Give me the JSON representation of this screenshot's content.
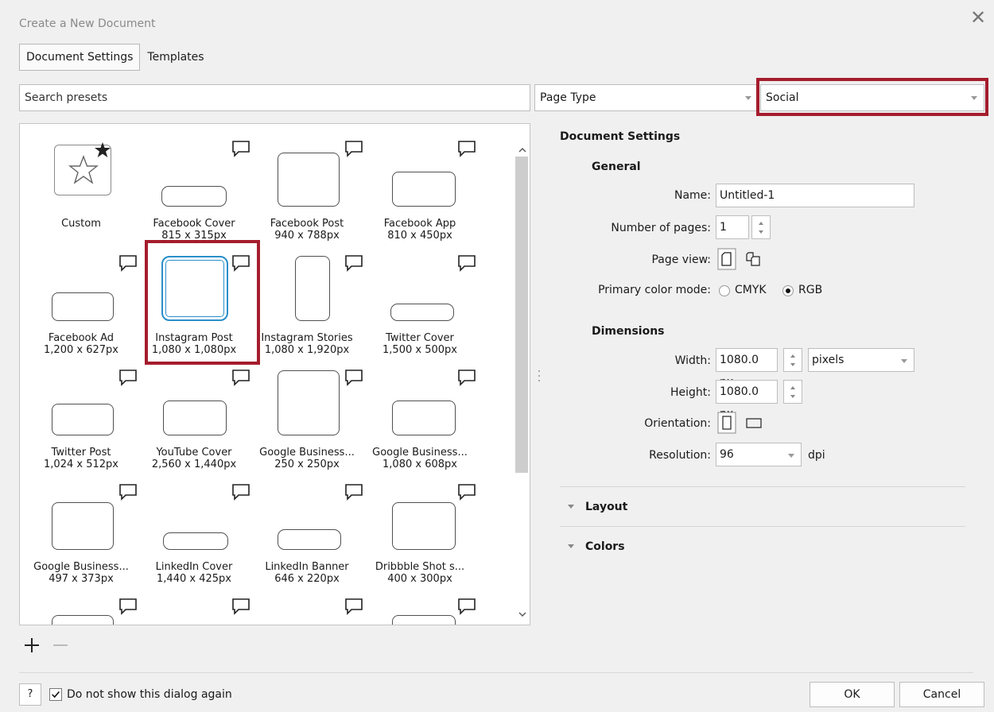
{
  "window": {
    "title": "Create a New Document"
  },
  "tabs": [
    {
      "label": "Document Settings",
      "active": true
    },
    {
      "label": "Templates",
      "active": false
    }
  ],
  "search": {
    "placeholder": "Search presets"
  },
  "filters": {
    "page_type": "Page Type",
    "category": "Social"
  },
  "presets": [
    {
      "name": "Custom",
      "size": ""
    },
    {
      "name": "Facebook Cover",
      "size": "815 x 315px"
    },
    {
      "name": "Facebook Post",
      "size": "940 x 788px"
    },
    {
      "name": "Facebook App",
      "size": "810 x 450px"
    },
    {
      "name": "Facebook Ad",
      "size": "1,200 x 627px"
    },
    {
      "name": "Instagram Post",
      "size": "1,080 x 1,080px"
    },
    {
      "name": "Instagram Stories",
      "size": "1,080 x 1,920px"
    },
    {
      "name": "Twitter Cover",
      "size": "1,500 x 500px"
    },
    {
      "name": "Twitter Post",
      "size": "1,024 x 512px"
    },
    {
      "name": "YouTube Cover",
      "size": "2,560 x 1,440px"
    },
    {
      "name": "Google Business...",
      "size": "250 x 250px"
    },
    {
      "name": "Google Business...",
      "size": "1,080 x 608px"
    },
    {
      "name": "Google Business...",
      "size": "497 x 373px"
    },
    {
      "name": "LinkedIn Cover",
      "size": "1,440 x 425px"
    },
    {
      "name": "LinkedIn Banner",
      "size": "646 x 220px"
    },
    {
      "name": "Dribbble Shot s...",
      "size": "400 x 300px"
    }
  ],
  "settings": {
    "heading": "Document Settings",
    "general": {
      "heading": "General",
      "name_label": "Name:",
      "name_value": "Untitled-1",
      "pages_label": "Number of pages:",
      "pages_value": "1",
      "page_view_label": "Page view:",
      "color_mode_label": "Primary color mode:",
      "cmyk_label": "CMYK",
      "rgb_label": "RGB"
    },
    "dimensions": {
      "heading": "Dimensions",
      "width_label": "Width:",
      "width_value": "1080.0 px",
      "unit": "pixels",
      "height_label": "Height:",
      "height_value": "1080.0 px",
      "orientation_label": "Orientation:",
      "resolution_label": "Resolution:",
      "resolution_value": "96",
      "resolution_unit": "dpi"
    },
    "layout_label": "Layout",
    "colors_label": "Colors"
  },
  "footer": {
    "help_label": "?",
    "checkbox_label": "Do not show this dialog again",
    "ok_label": "OK",
    "cancel_label": "Cancel"
  },
  "colors": {
    "highlight": "#a51d2d",
    "selected_outline": "#2a8fc9"
  }
}
